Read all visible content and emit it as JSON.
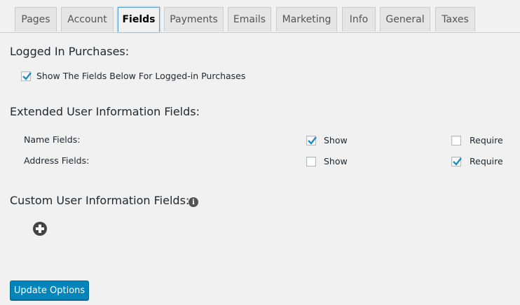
{
  "tabs": [
    "Pages",
    "Account",
    "Fields",
    "Payments",
    "Emails",
    "Marketing",
    "Info",
    "General",
    "Taxes"
  ],
  "active_tab": "Fields",
  "logged_in": {
    "heading": "Logged In Purchases:",
    "checkbox_label": "Show The Fields Below For Logged-in Purchases",
    "checked": true
  },
  "extended": {
    "heading": "Extended User Information Fields:",
    "rows": [
      {
        "label": "Name Fields:",
        "show_label": "Show",
        "show": true,
        "require_label": "Require",
        "require": false
      },
      {
        "label": "Address Fields:",
        "show_label": "Show",
        "show": false,
        "require_label": "Require",
        "require": true
      }
    ]
  },
  "custom": {
    "heading": "Custom User Information Fields:",
    "info_icon": "info-icon",
    "add_icon": "plus-circle-icon"
  },
  "submit_label": "Update Options"
}
